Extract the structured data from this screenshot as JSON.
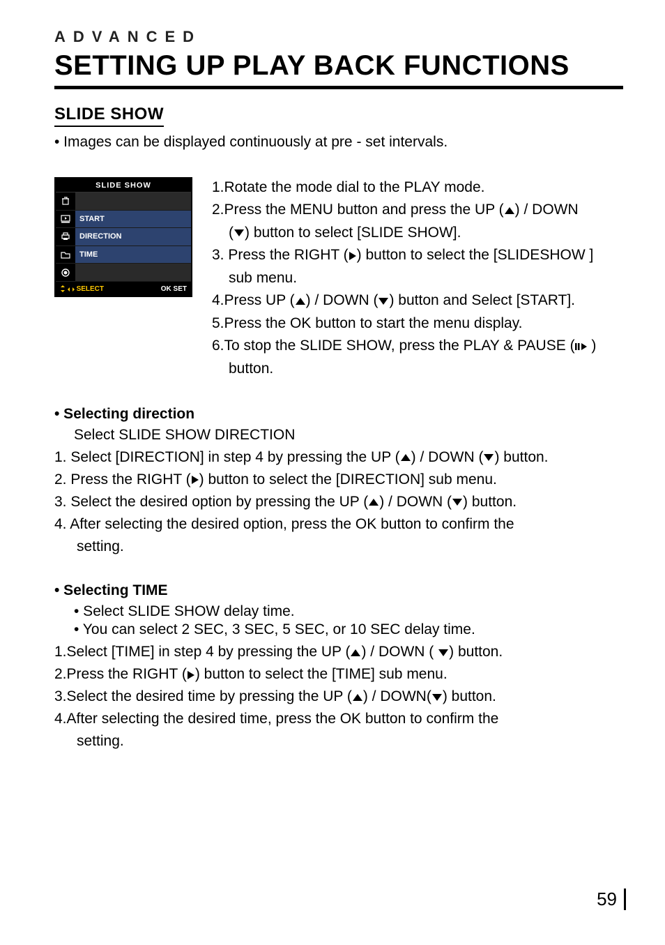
{
  "section_label": "ADVANCED",
  "title": "SETTING UP PLAY BACK FUNCTIONS",
  "subhead": "SLIDE SHOW",
  "intro": "• Images can be displayed continuously at pre - set intervals.",
  "lcd": {
    "title": "SLIDE SHOW",
    "rows": [
      "START",
      "DIRECTION",
      "TIME"
    ],
    "icons": [
      "delete-icon",
      "slideshow-icon",
      "print-icon",
      "folder-icon",
      "record-icon"
    ],
    "bottom_left_label": "SELECT",
    "bottom_right_label": "OK  SET"
  },
  "steps": {
    "s1": "1.Rotate the mode dial to the PLAY mode.",
    "s2a": "2.Press the MENU button and press the UP (",
    "s2b": ") / DOWN",
    "s2c": "(",
    "s2d": ") button to select [SLIDE SHOW].",
    "s3a": "3. Press the RIGHT (",
    "s3b": ") button to select the [SLIDESHOW ]",
    "s3c": "sub menu.",
    "s4a": "4.Press UP (",
    "s4b": ") / DOWN  (",
    "s4c": ") button and Select [START].",
    "s5": "5.Press the OK button to start the menu display.",
    "s6a": "6.To stop the SLIDE SHOW, press the PLAY & PAUSE (",
    "s6b": ")",
    "s6c": "button."
  },
  "direction": {
    "head": "•  Selecting direction",
    "note": "Select SLIDE SHOW DIRECTION",
    "d1a": "1. Select [DIRECTION] in step 4 by pressing the UP (",
    "d1b": ") / DOWN (",
    "d1c": ") button.",
    "d2a": "2. Press the RIGHT (",
    "d2b": ") button to select the [DIRECTION] sub menu.",
    "d3a": "3. Select the desired option by pressing the UP (",
    "d3b": ") / DOWN (",
    "d3c": ") button.",
    "d4a": "4. After selecting the desired option, press the OK button to confirm the",
    "d4b": "setting."
  },
  "time": {
    "head": "• Selecting TIME",
    "note1": "• Select SLIDE SHOW delay time.",
    "note2": "• You can select 2 SEC, 3 SEC, 5 SEC, or 10 SEC delay time.",
    "t1a": "1.Select [TIME] in step 4 by pressing the UP (",
    "t1b": ") / DOWN (",
    "t1c": ") button.",
    "t2a": "2.Press the RIGHT (",
    "t2b": ") button to select the [TIME] sub menu.",
    "t3a": "3.Select the desired time by pressing the UP (",
    "t3b": ") / DOWN(",
    "t3c": ") button.",
    "t4a": "4.After selecting the desired time, press the OK button to confirm the",
    "t4b": "setting."
  },
  "page_number": "59"
}
